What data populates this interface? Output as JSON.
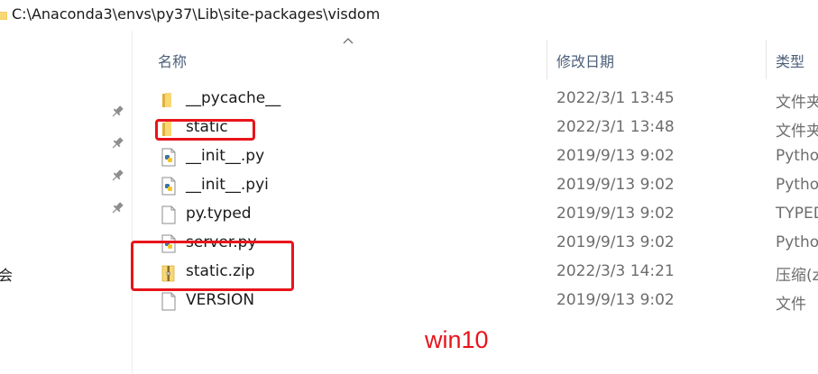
{
  "window": {
    "path": "C:\\Anaconda3\\envs\\py37\\Lib\\site-packages\\visdom",
    "left_partial_text": "会"
  },
  "columns": {
    "name": "名称",
    "date_modified": "修改日期",
    "type": "类型",
    "sort_indicator": "chevron-up-icon"
  },
  "files": [
    {
      "name": "__pycache__",
      "date": "2022/3/1 13:45",
      "type": "文件夹",
      "icon": "folder-icon"
    },
    {
      "name": "static",
      "date": "2022/3/1 13:48",
      "type": "文件夹",
      "icon": "folder-icon"
    },
    {
      "name": "__init__.py",
      "date": "2019/9/13 9:02",
      "type": "Python",
      "icon": "python-file-icon"
    },
    {
      "name": "__init__.pyi",
      "date": "2019/9/13 9:02",
      "type": "Python",
      "icon": "python-file-icon"
    },
    {
      "name": "py.typed",
      "date": "2019/9/13 9:02",
      "type": "TYPED",
      "icon": "blank-file-icon"
    },
    {
      "name": "server.py",
      "date": "2019/9/13 9:02",
      "type": "Python",
      "icon": "python-file-icon"
    },
    {
      "name": "static.zip",
      "date": "2022/3/3 14:21",
      "type": "压缩(zip",
      "icon": "zip-folder-icon"
    },
    {
      "name": "VERSION",
      "date": "2019/9/13 9:02",
      "type": "文件",
      "icon": "blank-file-icon"
    }
  ],
  "quick_access_pins": [
    "pin-icon",
    "pin-icon",
    "pin-icon",
    "pin-icon"
  ],
  "annotation": {
    "label": "win10",
    "color": "#e8141b"
  },
  "colors": {
    "header_text": "#4c607a",
    "folder": "#f8d775",
    "python_blue": "#3873a6",
    "python_yellow": "#f5c625"
  }
}
